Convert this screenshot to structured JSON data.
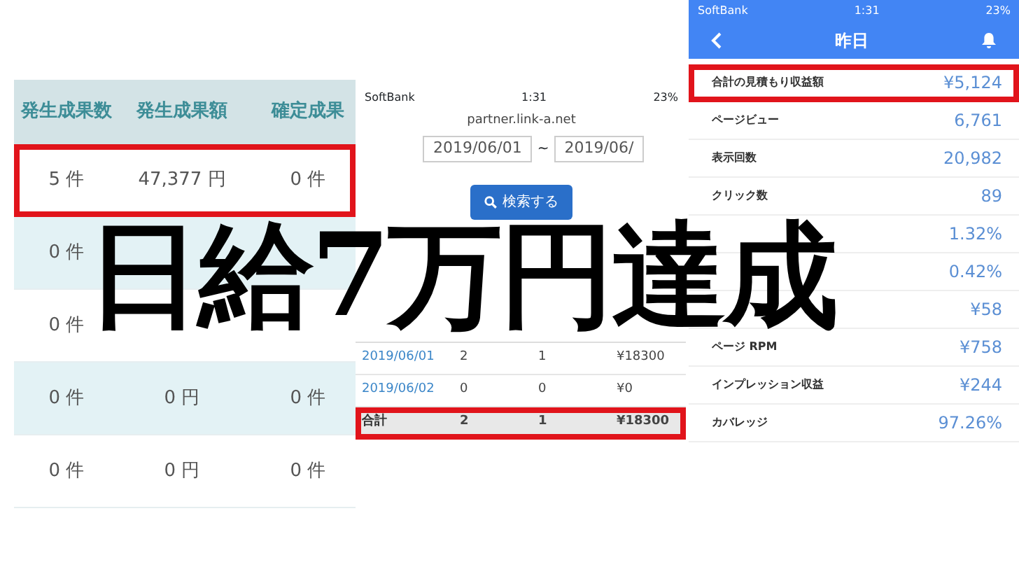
{
  "overlay_title": "日給7万円達成",
  "results_table": {
    "columns": [
      "発生成果数",
      "発生成果額",
      "確定成果"
    ],
    "rows": [
      {
        "cells": [
          "5 件",
          "47,377 円",
          "0 件"
        ],
        "highlighted": true
      },
      {
        "cells": [
          "0 件",
          null,
          null
        ],
        "highlighted": false
      },
      {
        "cells": [
          "0 件",
          null,
          null
        ],
        "highlighted": false
      },
      {
        "cells": [
          "0 件",
          "0 円",
          "0 件"
        ],
        "highlighted": false
      },
      {
        "cells": [
          "0 件",
          "0 円",
          "0 件"
        ],
        "highlighted": false
      }
    ]
  },
  "affiliate_screen": {
    "status_bar": {
      "carrier": "SoftBank",
      "time": "1:31",
      "battery": "23%"
    },
    "url": "partner.link-a.net",
    "date_from": "2019/06/01",
    "date_separator": "~",
    "date_to": "2019/06/",
    "search_button": "検索する",
    "rows": [
      {
        "cells": [
          "2019/06/01",
          "2",
          "1",
          "¥18300"
        ],
        "kind": "date",
        "highlighted": false
      },
      {
        "cells": [
          "2019/06/02",
          "0",
          "0",
          "¥0"
        ],
        "kind": "date",
        "highlighted": false
      },
      {
        "cells": [
          "合計",
          "2",
          "1",
          "¥18300"
        ],
        "kind": "total",
        "highlighted": true
      }
    ]
  },
  "adsense_screen": {
    "status_bar": {
      "carrier": "SoftBank",
      "time": "1:31",
      "battery": "23%"
    },
    "title": "昨日",
    "rows": [
      {
        "label": "合計の見積もり収益額",
        "value": "¥5,124",
        "highlighted": true
      },
      {
        "label": "ページビュー",
        "value": "6,761",
        "highlighted": false
      },
      {
        "label": "表示回数",
        "value": "20,982",
        "highlighted": false
      },
      {
        "label": "クリック数",
        "value": "89",
        "highlighted": false
      },
      {
        "label": null,
        "value": "1.32%",
        "highlighted": false
      },
      {
        "label": null,
        "value": "0.42%",
        "highlighted": false
      },
      {
        "label": null,
        "value": "¥58",
        "highlighted": false
      },
      {
        "label": "ページ RPM",
        "value": "¥758",
        "highlighted": false
      },
      {
        "label": "インプレッション収益",
        "value": "¥244",
        "highlighted": false
      },
      {
        "label": "カバレッジ",
        "value": "97.26%",
        "highlighted": false
      }
    ]
  }
}
